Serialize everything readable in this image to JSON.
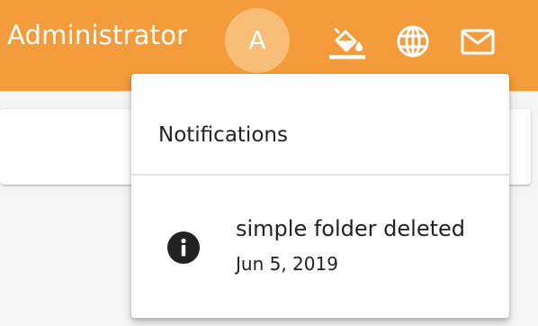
{
  "header": {
    "user_name": "Administrator",
    "avatar_initial": "A",
    "icons": [
      "paint-bucket-icon",
      "globe-icon",
      "mail-icon"
    ]
  },
  "notifications": {
    "title": "Notifications",
    "items": [
      {
        "icon": "info-icon",
        "message": "simple folder deleted",
        "date": "Jun 5, 2019"
      }
    ]
  },
  "colors": {
    "header_bg": "#f49c3c",
    "avatar_bg": "#f8bd76",
    "panel_bg": "#ffffff",
    "text": "#222222"
  }
}
